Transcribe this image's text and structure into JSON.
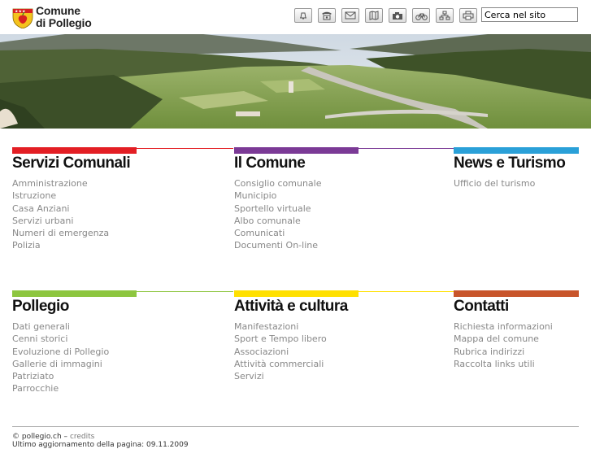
{
  "header": {
    "site_name_line1": "Comune",
    "site_name_line2": "di Pollegio",
    "toolbar_icons": [
      "bell-icon",
      "phone-icon",
      "mail-icon",
      "map-icon",
      "camera-icon",
      "bike-icon",
      "sitemap-icon",
      "print-icon"
    ],
    "search": {
      "value": "Cerca nel sito"
    }
  },
  "sections": [
    {
      "title": "Servizi Comunali",
      "color": "#e31e24",
      "links": [
        "Amministrazione",
        "Istruzione",
        "Casa Anziani",
        "Servizi urbani",
        "Numeri di emergenza",
        "Polizia"
      ]
    },
    {
      "title": "Il Comune",
      "color": "#7b3a96",
      "links": [
        "Consiglio comunale",
        "Municipio",
        "Sportello virtuale",
        "Albo comunale",
        "Comunicati",
        "Documenti On-line"
      ]
    },
    {
      "title": "News e Turismo",
      "color": "#2aa0d8",
      "links": [
        "Ufficio del turismo"
      ]
    },
    {
      "title": "Pollegio",
      "color": "#8dc63f",
      "links": [
        "Dati generali",
        "Cenni storici",
        "Evoluzione di Pollegio",
        "Gallerie di immagini",
        "Patriziato",
        "Parrocchie"
      ]
    },
    {
      "title": "Attività e cultura",
      "color": "#ffe000",
      "links": [
        "Manifestazioni",
        "Sport e Tempo libero",
        "Associazioni",
        "Attività commerciali",
        "Servizi"
      ]
    },
    {
      "title": "Contatti",
      "color": "#c8552b",
      "links": [
        "Richiesta informazioni",
        "Mappa del comune",
        "Rubrica indirizzi",
        "Raccolta links utili"
      ]
    }
  ],
  "footer": {
    "copyright": "© pollegio.ch –",
    "credits": "credits",
    "updated": "Ultimo aggiornamento della pagina: 09.11.2009"
  }
}
